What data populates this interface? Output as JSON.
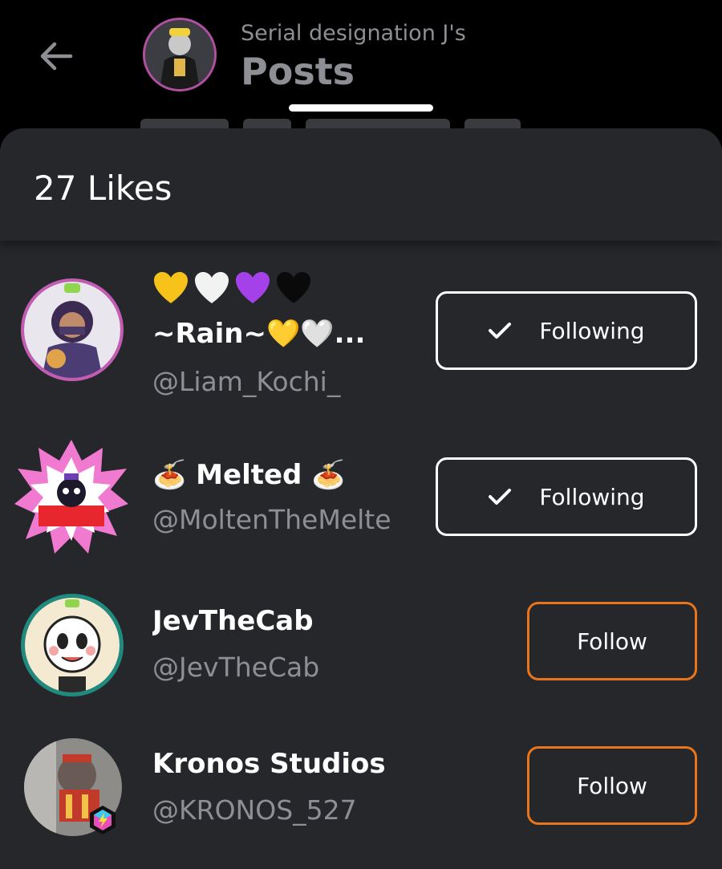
{
  "header": {
    "subtitle": "Serial designation J's",
    "title": "Posts"
  },
  "sheet": {
    "likes_label": "27 Likes"
  },
  "users": [
    {
      "name_line1_emojis": [
        "yellow-heart",
        "white-heart",
        "purple-heart",
        "black-heart"
      ],
      "name": "~Rain~💛🤍...",
      "handle": "@Liam_Kochi_",
      "button_label": "Following",
      "following": true
    },
    {
      "name": "🍝 Melted 🍝",
      "handle": "@MoltenTheMelte",
      "button_label": "Following",
      "following": true
    },
    {
      "name": "JevTheCab",
      "handle": "@JevTheCab",
      "button_label": "Follow",
      "following": false
    },
    {
      "name": "Kronos Studios",
      "handle": "@KRONOS_527",
      "button_label": "Follow",
      "following": false
    }
  ],
  "colors": {
    "background": "#000000",
    "sheet": "#25272b",
    "text_primary": "#ffffff",
    "text_secondary": "#8d8f94",
    "follow_accent": "#e8741c"
  }
}
